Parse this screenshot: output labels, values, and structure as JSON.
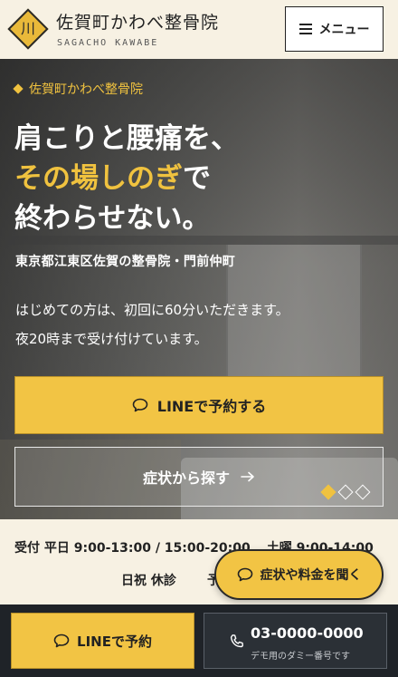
{
  "header": {
    "logo_char": "川",
    "brand_name": "佐賀町かわべ整骨院",
    "brand_roman": "SAGACHO KAWABE",
    "menu_label": "メニュー"
  },
  "hero": {
    "tag": "佐賀町かわべ整骨院",
    "headline_line1": "肩こりと腰痛を、",
    "headline_line2_highlight": "その場しのぎ",
    "headline_line2_rest": "で",
    "headline_line3": "終わらせない。",
    "subline": "東京都江東区佐賀の整骨院・門前仲町",
    "intro_line1": "はじめての方は、初回に60分いただきます。",
    "intro_line2": "夜20時まで受け付けています。",
    "line_button": "LINEで予約する",
    "symptom_button": "症状から探す",
    "slide_count": 3,
    "slide_active": 1
  },
  "hours": {
    "line1_a": "受付 平日 9:00-13:00 / 15:00-20:00",
    "line1_b": "土曜 9:00-14:00",
    "line2": "日祝 休診",
    "line2_trail": "予"
  },
  "floating": {
    "label": "症状や料金を聞く"
  },
  "bottom_bar": {
    "line_label": "LINEで予約",
    "tel_number": "03-0000-0000",
    "tel_note": "デモ用のダミー番号です"
  },
  "colors": {
    "accent": "#f2c444",
    "cream": "#f7f1e3",
    "dark": "#1f2328"
  },
  "icons": {
    "menu": "hamburger-icon",
    "chat": "chat-bubble-icon",
    "arrow": "arrow-right-icon",
    "phone": "phone-icon"
  }
}
